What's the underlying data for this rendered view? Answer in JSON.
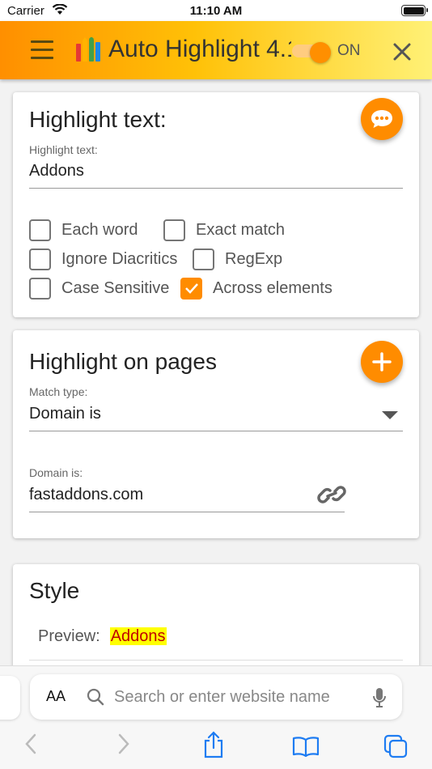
{
  "status_bar": {
    "carrier": "Carrier",
    "time": "11:10 AM"
  },
  "app_bar": {
    "title": "Auto Highlight 4.1",
    "toggle_label": "ON",
    "toggle_on": true
  },
  "highlight_text_card": {
    "title": "Highlight text:",
    "field_label": "Highlight text:",
    "field_value": "Addons",
    "options": [
      {
        "label": "Each word",
        "checked": false
      },
      {
        "label": "Exact match",
        "checked": false
      },
      {
        "label": "Ignore Diacritics",
        "checked": false
      },
      {
        "label": "RegExp",
        "checked": false
      },
      {
        "label": "Case Sensitive",
        "checked": false
      },
      {
        "label": "Across elements",
        "checked": true
      }
    ]
  },
  "pages_card": {
    "title": "Highlight on pages",
    "match_label": "Match type:",
    "match_value": "Domain is",
    "domain_label": "Domain is:",
    "domain_value": "fastaddons.com"
  },
  "style_card": {
    "title": "Style",
    "preview_label": "Preview:",
    "preview_text": "Addons"
  },
  "browser": {
    "text_size_label": "AA",
    "search_placeholder": "Search or enter website name"
  },
  "colors": {
    "accent": "#ff8c00",
    "highlight_bg": "#ffff00",
    "highlight_fg": "#c00000",
    "ios_blue": "#1e7cf2"
  }
}
